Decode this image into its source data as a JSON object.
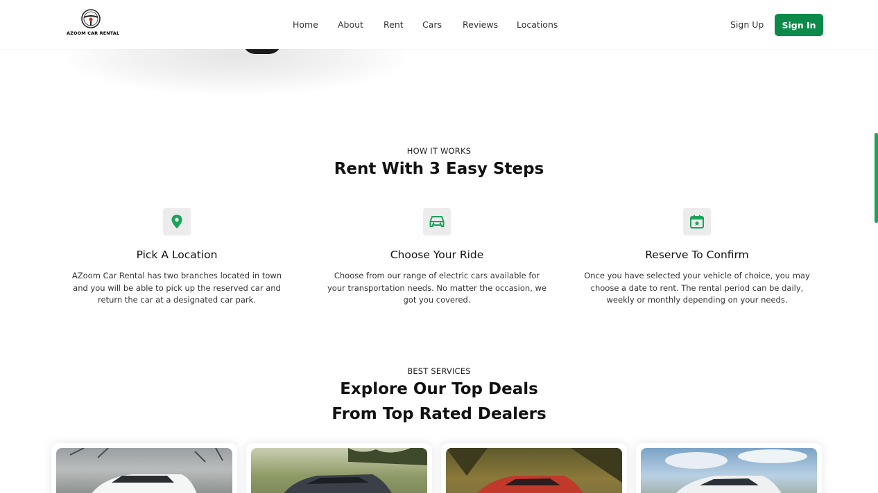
{
  "brand": {
    "name": "AZOOM CAR RENTAL"
  },
  "nav": {
    "links": [
      "Home",
      "About",
      "Rent",
      "Cars",
      "Reviews",
      "Locations"
    ],
    "sign_up": "Sign Up",
    "sign_in": "Sign In"
  },
  "colors": {
    "accent": "#0b8a4a",
    "icon_green": "#1aa35a",
    "icon_bg": "#ececec"
  },
  "how_it_works": {
    "eyebrow": "HOW IT WORKS",
    "title": "Rent With 3 Easy Steps",
    "steps": [
      {
        "icon": "location-pin-icon",
        "title": "Pick A Location",
        "desc_lines": [
          "AZoom Car Rental has two branches located in town",
          "and you will be able to pick up the reserved car and",
          "return the car at a designated car park."
        ]
      },
      {
        "icon": "car-icon",
        "title": "Choose Your Ride",
        "desc_lines": [
          "Choose from our range of electric cars available for",
          "your transportation needs. No matter the occasion, we",
          "got you covered."
        ]
      },
      {
        "icon": "calendar-star-icon",
        "title": "Reserve To Confirm",
        "desc_lines": [
          "Once you have selected your vehicle of choice, you may",
          "choose a date to rent. The rental period can be daily,",
          "weekly or monthly depending on your needs."
        ]
      }
    ]
  },
  "best_services": {
    "eyebrow": "BEST SERVICES",
    "title_line1": "Explore Our Top Deals",
    "title_line2": "From Top Rated Dealers"
  },
  "deals": [
    {
      "icon": "white-car-photo"
    },
    {
      "icon": "dark-car-photo"
    },
    {
      "icon": "red-car-photo"
    },
    {
      "icon": "white-sports-car-photo"
    }
  ]
}
